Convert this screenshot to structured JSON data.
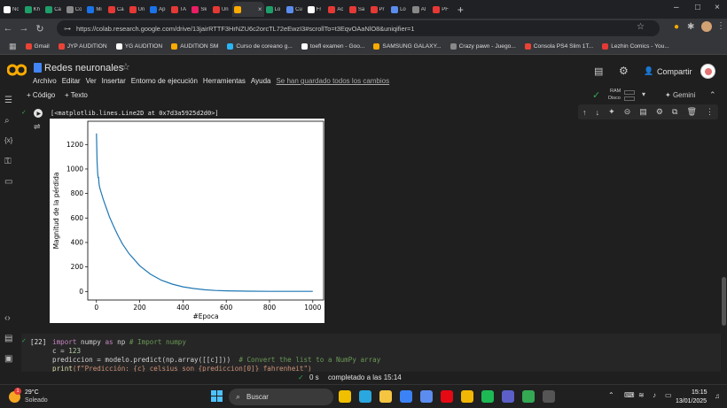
{
  "browser": {
    "tabs": [
      {
        "label": "Nc",
        "color": "#ffffff"
      },
      {
        "label": "Kh",
        "color": "#1e9e6a"
      },
      {
        "label": "Ca",
        "color": "#1e9e6a"
      },
      {
        "label": "Co",
        "color": "#888888"
      },
      {
        "label": "Mi",
        "color": "#1a73e8"
      },
      {
        "label": "Ca",
        "color": "#e53935"
      },
      {
        "label": "Un",
        "color": "#e53935"
      },
      {
        "label": "Ap",
        "color": "#1a73e8"
      },
      {
        "label": "TA",
        "color": "#e53935"
      },
      {
        "label": "Sk",
        "color": "#e91e63"
      },
      {
        "label": "Un",
        "color": "#e53935"
      },
      {
        "label": "",
        "color": "#f9ab00"
      },
      {
        "label": "Lo",
        "color": "#1e9e6a"
      },
      {
        "label": "Cu",
        "color": "#5b8def"
      },
      {
        "label": "Fr",
        "color": "#ffffff"
      },
      {
        "label": "Ac",
        "color": "#e53935"
      },
      {
        "label": "Sa",
        "color": "#e53935"
      },
      {
        "label": "Pr",
        "color": "#e53935"
      },
      {
        "label": "Lo",
        "color": "#5b8def"
      },
      {
        "label": "Al",
        "color": "#888888"
      },
      {
        "label": "PF",
        "color": "#e53935"
      }
    ],
    "url": "https://colab.research.google.com/drive/13jairRTTF3HrNZU6c2orcTL72eEwzI3#scrollTo=t3EqvOAaNlO8&uniqifier=1",
    "bookmarks": [
      {
        "label": "Gmail",
        "color": "#ea4335"
      },
      {
        "label": "JYP AUDITION",
        "color": "#ea4335"
      },
      {
        "label": "YG AUDITION",
        "color": "#ffffff"
      },
      {
        "label": "AUDITION SM",
        "color": "#f9ab00"
      },
      {
        "label": "Curso de coreano g...",
        "color": "#29b6f6"
      },
      {
        "label": "toefl examen - Goo...",
        "color": "#ffffff"
      },
      {
        "label": "SAMSUNG GALAXY...",
        "color": "#f9ab00"
      },
      {
        "label": "Crazy pawn - Juego...",
        "color": "#888888"
      },
      {
        "label": "Consola PS4 Slim 1T...",
        "color": "#ea4335"
      },
      {
        "label": "Lezhin Comics - You...",
        "color": "#e53935"
      }
    ]
  },
  "colab": {
    "title": "Redes neuronales",
    "menus": [
      "Archivo",
      "Editar",
      "Ver",
      "Insertar",
      "Entorno de ejecución",
      "Herramientas",
      "Ayuda"
    ],
    "saved_status": "Se han guardado todos los cambios",
    "share_label": "Compartir",
    "add_code": "+ Código",
    "add_text": "+ Texto",
    "ram_label": "RAM",
    "disk_label": "Disco",
    "gemini_label": "Gemini"
  },
  "output": {
    "text": "[<matplotlib.lines.Line2D at 0x7d3a5925d2d0>]"
  },
  "chart_data": {
    "type": "line",
    "xlabel": "#Epoca",
    "ylabel": "Magnitud de la pérdida",
    "xlim": [
      -40,
      1050
    ],
    "ylim": [
      -70,
      1390
    ],
    "xticks": [
      0,
      200,
      400,
      600,
      800,
      1000
    ],
    "yticks": [
      0,
      200,
      400,
      600,
      800,
      1000,
      1200
    ],
    "color": "#1f77b4",
    "series": [
      {
        "x": [
          0,
          3,
          6,
          8,
          10,
          12,
          15,
          18,
          20,
          25,
          30,
          40,
          50,
          60,
          80,
          100,
          120,
          150,
          200,
          250,
          300,
          350,
          400,
          450,
          500,
          550,
          600,
          700,
          800,
          900,
          1000
        ],
        "y": [
          1290,
          1060,
          960,
          930,
          930,
          880,
          850,
          830,
          820,
          790,
          760,
          710,
          660,
          610,
          530,
          455,
          390,
          310,
          210,
          140,
          92,
          60,
          38,
          24,
          14,
          8,
          5,
          2,
          1,
          1,
          1
        ]
      }
    ]
  },
  "code": {
    "exec_count": "[22]",
    "lines": [
      {
        "a": "import",
        "b": " numpy ",
        "c": "as",
        "d": " np ",
        "e": "# Import numpy"
      },
      {
        "a": "c = ",
        "b": "123"
      },
      {
        "a": "prediccion = modelo.predict(np.array([[c]]))  ",
        "b": "# Convert the list to a NumPy array"
      },
      {
        "a": "print",
        "b": "(f\"Predicción: {c} celsius son {prediccion[0]} fahrenheit\")"
      }
    ]
  },
  "status": {
    "time": "0 s",
    "completed": "completado a las 15:14"
  },
  "taskbar": {
    "temp": "29°C",
    "weather": "Soleado",
    "search": "Buscar",
    "clock_time": "15:15",
    "clock_date": "13/01/2025",
    "weather_badge": "1"
  }
}
